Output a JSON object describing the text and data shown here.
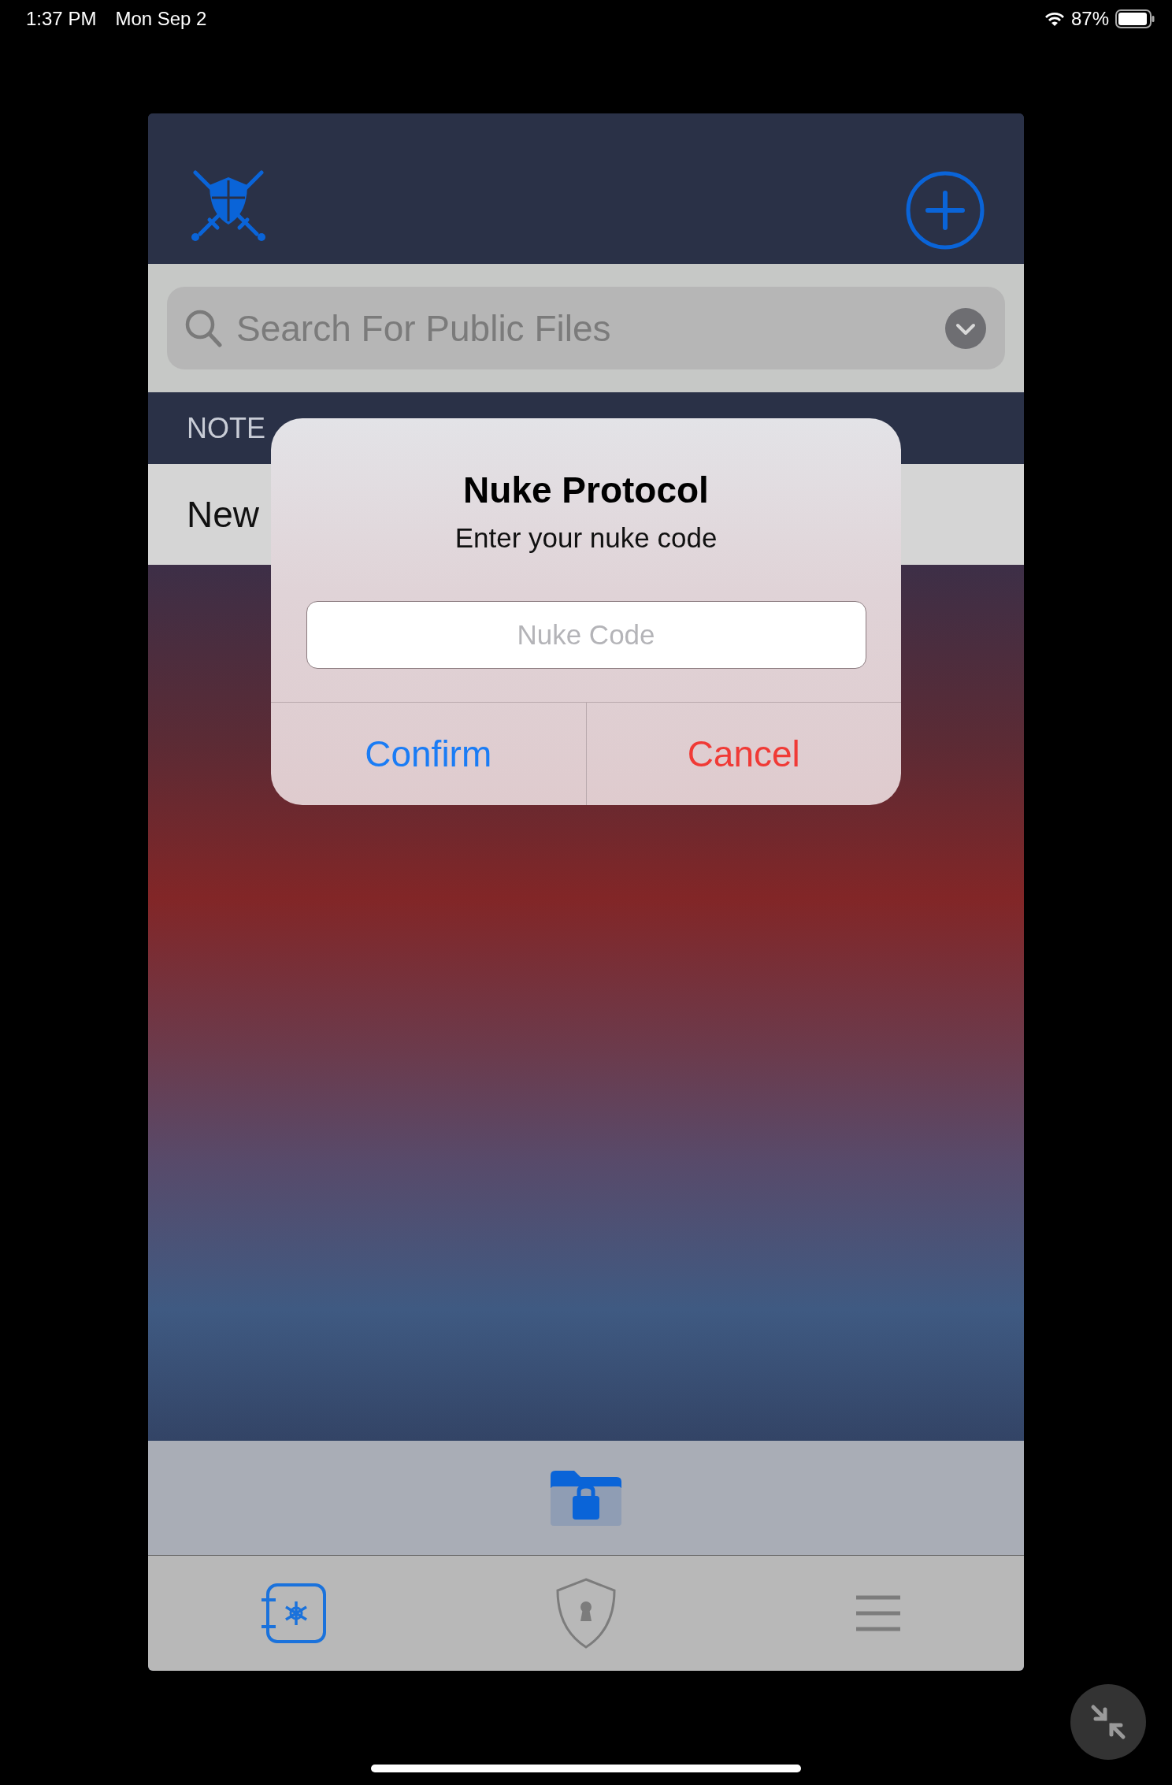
{
  "status_bar": {
    "time": "1:37 PM",
    "date": "Mon Sep 2",
    "battery": "87%"
  },
  "search": {
    "placeholder": "Search For Public Files"
  },
  "section_header": "NOTE",
  "rows": [
    {
      "title": "New"
    }
  ],
  "dialog": {
    "title": "Nuke Protocol",
    "message": "Enter your nuke code",
    "field": {
      "placeholder": "Nuke Code"
    },
    "buttons": [
      {
        "label": "Confirm",
        "kind": "default"
      },
      {
        "label": "Cancel",
        "kind": "destructive"
      }
    ]
  },
  "tabs": [
    {
      "kind": "vault",
      "selected": true
    },
    {
      "kind": "shield",
      "selected": false
    },
    {
      "kind": "menu",
      "selected": false
    }
  ]
}
